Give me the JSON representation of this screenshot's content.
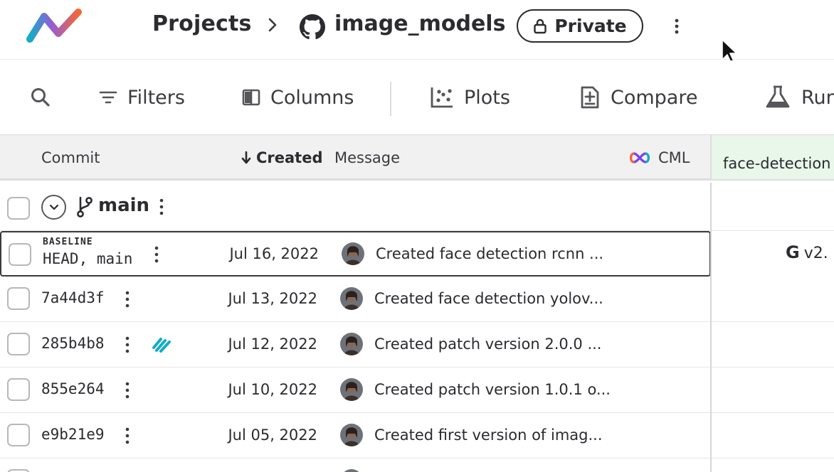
{
  "header": {
    "breadcrumb_projects": "Projects",
    "repo_name": "image_models",
    "visibility_label": "Private",
    "icons": [
      "logo-icon",
      "chevron-right-icon",
      "github-icon",
      "lock-icon",
      "kebab-menu-icon",
      "mouse-cursor-icon"
    ]
  },
  "toolbar": {
    "filters_label": "Filters",
    "columns_label": "Columns",
    "plots_label": "Plots",
    "compare_label": "Compare",
    "run_label": "Run",
    "icons": [
      "search-icon",
      "filter-icon",
      "columns-icon",
      "plots-icon",
      "compare-icon",
      "flask-icon"
    ]
  },
  "table": {
    "columns": {
      "commit": "Commit",
      "created": "Created",
      "message": "Message",
      "cml": "CML",
      "group": "face-detection"
    },
    "branch": {
      "name": "main"
    },
    "baseline_tag": "BASELINE",
    "rows": [
      {
        "commit": "HEAD, main",
        "date": "Jul 16, 2022",
        "message": "Created face detection rcnn ...",
        "face_detection": {
          "letter": "G",
          "version": "v2."
        }
      },
      {
        "commit": "7a44d3f",
        "date": "Jul 13, 2022",
        "message": "Created face detection yolov..."
      },
      {
        "commit": "285b4b8",
        "date": "Jul 12, 2022",
        "message": "Created patch version 2.0.0 ..."
      },
      {
        "commit": "855e264",
        "date": "Jul 10, 2022",
        "message": "Created patch version 1.0.1 o..."
      },
      {
        "commit": "e9b21e9",
        "date": "Jul 05, 2022",
        "message": "Created first version of imag..."
      }
    ]
  },
  "colors": {
    "text": "#2b2b30",
    "header_bg": "#f1f1f2",
    "group_header_bg": "#e9f6ea",
    "dvc_badge": "#13adc7",
    "cml_purple": "#7b3ff2",
    "cml_orange": "#f46737"
  }
}
